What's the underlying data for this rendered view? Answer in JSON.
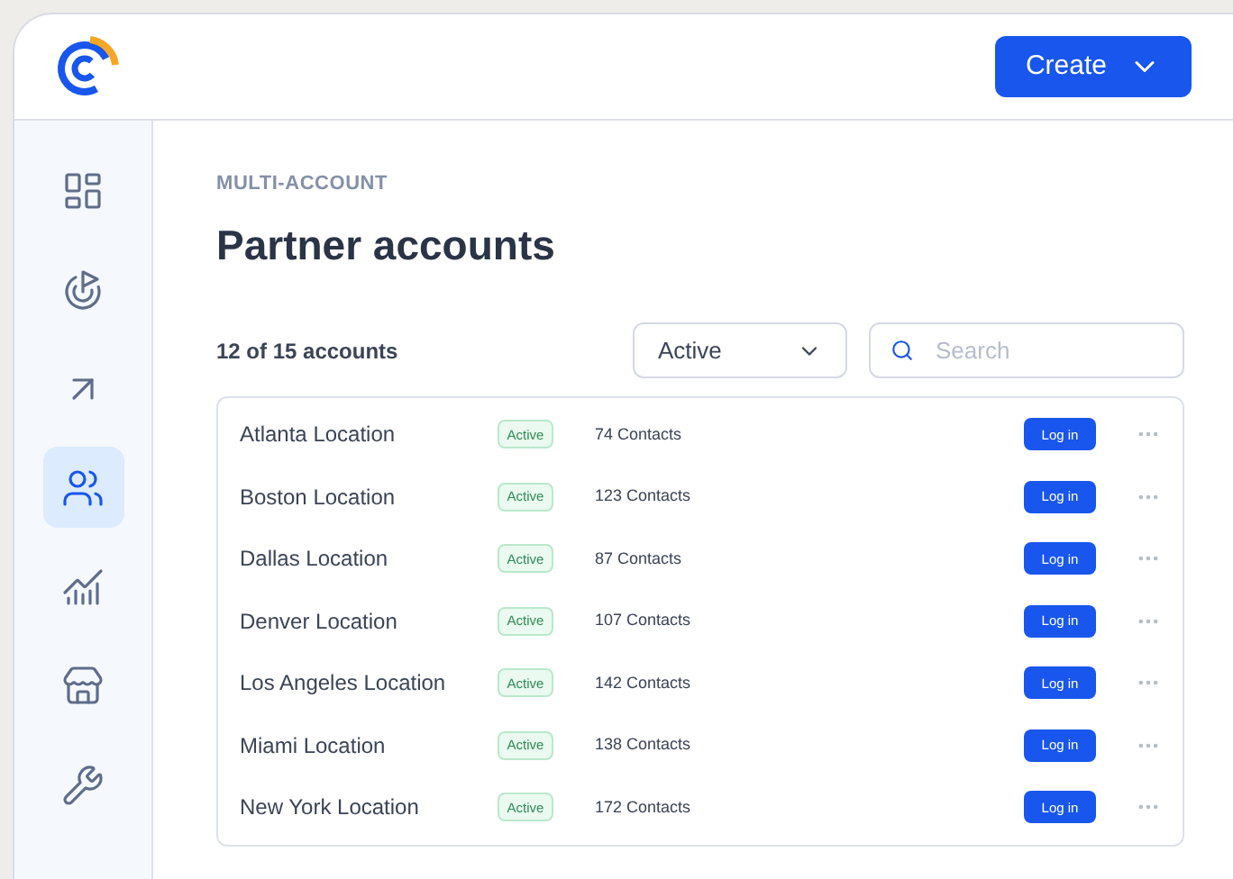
{
  "header": {
    "create_button": "Create"
  },
  "sidebar": {
    "items": [
      {
        "selected": false
      },
      {
        "selected": false
      },
      {
        "selected": false
      },
      {
        "selected": true
      },
      {
        "selected": false
      },
      {
        "selected": false
      },
      {
        "selected": false
      }
    ]
  },
  "eyebrow": "MULTI-ACCOUNT",
  "title": "Partner accounts",
  "count": "12 of 15 accounts",
  "filter": {
    "value": "Active"
  },
  "search": {
    "placeholder": "Search"
  },
  "rows": [
    {
      "name": "Atlanta Location",
      "status": "Active",
      "contacts": "74 Contacts",
      "action": "Log in"
    },
    {
      "name": "Boston Location",
      "status": "Active",
      "contacts": "123 Contacts",
      "action": "Log in"
    },
    {
      "name": "Dallas Location",
      "status": "Active",
      "contacts": "87 Contacts",
      "action": "Log in"
    },
    {
      "name": "Denver Location",
      "status": "Active",
      "contacts": "107 Contacts",
      "action": "Log in"
    },
    {
      "name": "Los Angeles Location",
      "status": "Active",
      "contacts": "142 Contacts",
      "action": "Log in"
    },
    {
      "name": "Miami Location",
      "status": "Active",
      "contacts": "138 Contacts",
      "action": "Log in"
    },
    {
      "name": "New York Location",
      "status": "Active",
      "contacts": "172 Contacts",
      "action": "Log in"
    }
  ]
}
